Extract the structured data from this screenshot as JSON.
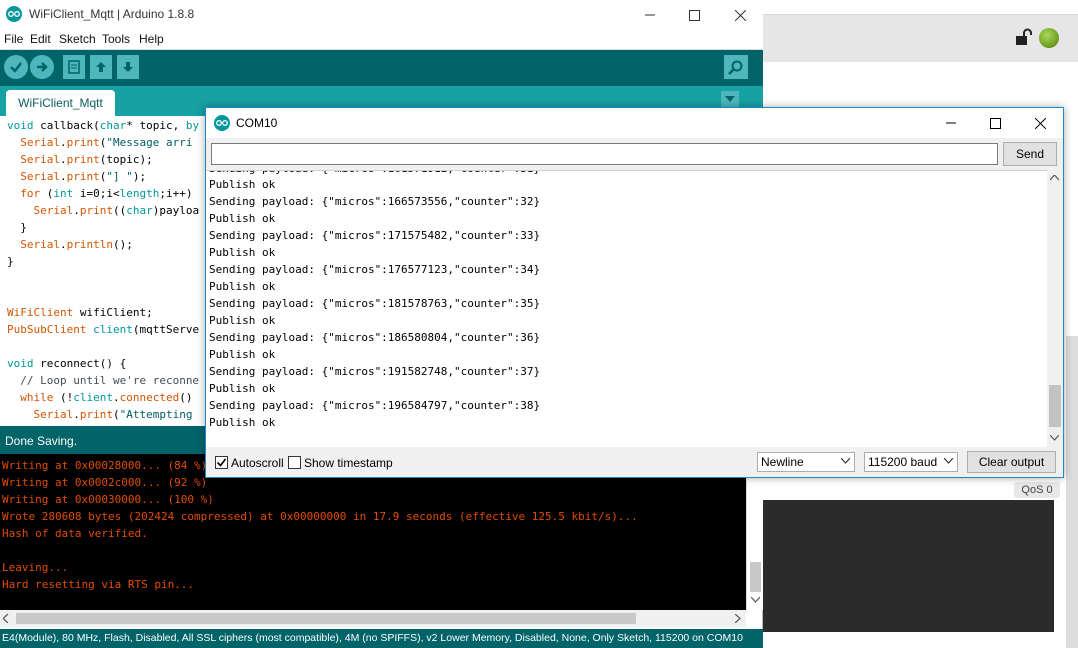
{
  "background_app": {
    "qos_badge": "QoS 0",
    "status_color": "#7fb52a"
  },
  "ide": {
    "title": "WiFiClient_Mqtt | Arduino 1.8.8",
    "menu": [
      "File",
      "Edit",
      "Sketch",
      "Tools",
      "Help"
    ],
    "toolbar": {
      "verify_icon": "check-icon",
      "upload_icon": "arrow-right-icon",
      "new_icon": "new-file-icon",
      "open_icon": "open-arrow-up-icon",
      "save_icon": "save-arrow-down-icon",
      "serial_monitor_icon": "magnifier-icon"
    },
    "tab_label": "WiFiClient_Mqtt",
    "code": [
      "void callback(char* topic, by",
      "  Serial.print(\"Message arri",
      "  Serial.print(topic);",
      "  Serial.print(\"] \");",
      "  for (int i=0;i<length;i++)",
      "    Serial.print((char)payloa",
      "  }",
      "  Serial.println();",
      "}",
      "",
      "",
      "WiFiClient wifiClient;",
      "PubSubClient client(mqttServe",
      "",
      "void reconnect() {",
      "  // Loop until we're reconne",
      "  while (!client.connected()",
      "    Serial.print(\"Attempting"
    ],
    "status": "Done Saving.",
    "console": [
      "Writing at 0x00028000... (84 %)",
      "Writing at 0x0002c000... (92 %)",
      "Writing at 0x00030000... (100 %)",
      "Wrote 280608 bytes (202424 compressed) at 0x00000000 in 17.9 seconds (effective 125.5 kbit/s)...",
      "Hash of data verified.",
      "",
      "Leaving...",
      "Hard resetting via RTS pin..."
    ],
    "board_info": "(Module), 80 MHz, Flash, Disabled, All SSL ciphers (most compatible), 4M (no SPIFFS), v2 Lower Memory, Disabled, None, Only Sketch, 115200 on COM10",
    "board_info_prefix": "E4"
  },
  "serial": {
    "title": "COM10",
    "input_value": "",
    "send_label": "Send",
    "output": [
      "Publish ok",
      "Sending payload: {\"micros\":166573556,\"counter\":32}",
      "Publish ok",
      "Sending payload: {\"micros\":171575482,\"counter\":33}",
      "Publish ok",
      "Sending payload: {\"micros\":176577123,\"counter\":34}",
      "Publish ok",
      "Sending payload: {\"micros\":181578763,\"counter\":35}",
      "Publish ok",
      "Sending payload: {\"micros\":186580804,\"counter\":36}",
      "Publish ok",
      "Sending payload: {\"micros\":191582748,\"counter\":37}",
      "Publish ok",
      "Sending payload: {\"micros\":196584797,\"counter\":38}",
      "Publish ok"
    ],
    "autoscroll_label": "Autoscroll",
    "autoscroll_checked": true,
    "timestamp_label": "Show timestamp",
    "timestamp_checked": false,
    "line_ending": "Newline",
    "baud": "115200 baud",
    "clear_label": "Clear output"
  },
  "colors": {
    "arduino_teal_dark": "#006468",
    "arduino_teal": "#17a1a5",
    "console_text": "#e34c00"
  }
}
